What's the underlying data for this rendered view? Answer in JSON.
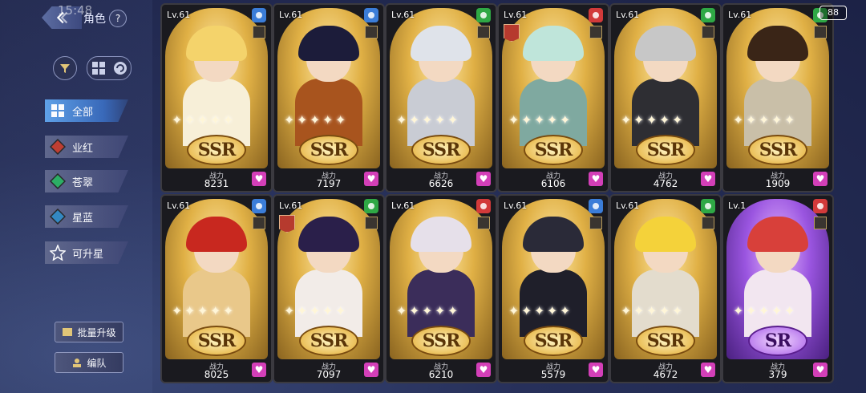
{
  "status_bar": {
    "time": "15:48",
    "fps": "88"
  },
  "header": {
    "title": "角色",
    "help": "?"
  },
  "categories": [
    {
      "label": "全部",
      "icon": "grid-icon",
      "color": "#4a90e2",
      "active": true
    },
    {
      "label": "业红",
      "icon": "red-element-icon",
      "color": "#c0392b"
    },
    {
      "label": "苍翠",
      "icon": "green-element-icon",
      "color": "#27ae60"
    },
    {
      "label": "星蓝",
      "icon": "blue-element-icon",
      "color": "#2e86c1"
    },
    {
      "label": "可升星",
      "icon": "star-upgrade-icon",
      "color": "#c8c8c8"
    }
  ],
  "bottom_buttons": {
    "bulk_upgrade": "批量升级",
    "team": "编队"
  },
  "power_label": "战力",
  "characters": [
    {
      "level": "Lv.61",
      "rarity": "SSR",
      "power": "8231",
      "element": "#3b7dd8",
      "hair": "#f4d36b",
      "outfit": "#f7efd8",
      "badge": false
    },
    {
      "level": "Lv.61",
      "rarity": "SSR",
      "power": "7197",
      "element": "#3b7dd8",
      "hair": "#1c1c3a",
      "outfit": "#a8541e",
      "badge": false
    },
    {
      "level": "Lv.61",
      "rarity": "SSR",
      "power": "6626",
      "element": "#2fa845",
      "hair": "#dfe3ea",
      "outfit": "#c9ccd4",
      "badge": false
    },
    {
      "level": "Lv.61",
      "rarity": "SSR",
      "power": "6106",
      "element": "#d23a3a",
      "hair": "#bfe5da",
      "outfit": "#7fa9a0",
      "badge": true
    },
    {
      "level": "Lv.61",
      "rarity": "SSR",
      "power": "4762",
      "element": "#2fa845",
      "hair": "#c7c7c7",
      "outfit": "#2e2e33",
      "badge": false
    },
    {
      "level": "Lv.61",
      "rarity": "SSR",
      "power": "1909",
      "element": "#2fa845",
      "hair": "#3a2517",
      "outfit": "#c9bfa8",
      "badge": false
    },
    {
      "level": "Lv.61",
      "rarity": "SSR",
      "power": "8025",
      "element": "#3b7dd8",
      "hair": "#c8281f",
      "outfit": "#e9c88a",
      "badge": false
    },
    {
      "level": "Lv.61",
      "rarity": "SSR",
      "power": "7097",
      "element": "#2fa845",
      "hair": "#2a1f4a",
      "outfit": "#f2ece8",
      "badge": true
    },
    {
      "level": "Lv.61",
      "rarity": "SSR",
      "power": "6210",
      "element": "#d23a3a",
      "hair": "#e6e0ea",
      "outfit": "#3b2d5a",
      "badge": false
    },
    {
      "level": "Lv.61",
      "rarity": "SSR",
      "power": "5579",
      "element": "#3b7dd8",
      "hair": "#2a2a38",
      "outfit": "#1f1f2a",
      "badge": false
    },
    {
      "level": "Lv.61",
      "rarity": "SSR",
      "power": "4672",
      "element": "#2fa845",
      "hair": "#f4d23a",
      "outfit": "#e3dccd",
      "badge": false
    },
    {
      "level": "Lv.1",
      "rarity": "SR",
      "power": "379",
      "element": "#d23a3a",
      "hair": "#d8403a",
      "outfit": "#f2e6f0",
      "badge": false
    }
  ]
}
